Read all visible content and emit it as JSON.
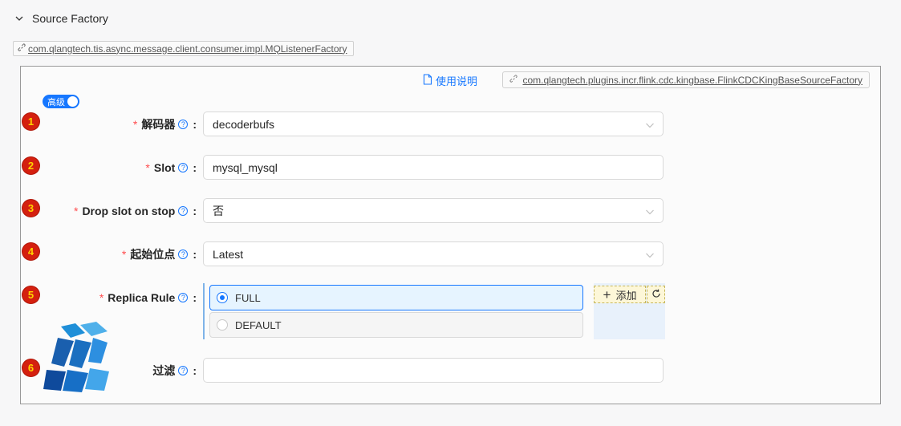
{
  "section": {
    "title": "Source Factory"
  },
  "class_tag": {
    "text": "com.qlangtech.tis.async.message.client.consumer.impl.MQListenerFactory"
  },
  "doc_link": {
    "label": "使用说明"
  },
  "impl_tag": {
    "text": "com.qlangtech.plugins.incr.flink.cdc.kingbase.FlinkCDCKingBaseSourceFactory"
  },
  "advanced_toggle": {
    "label": "高级",
    "on": true
  },
  "fields": [
    {
      "badge": "1",
      "label": "解码器",
      "required": true,
      "type": "select",
      "value": "decoderbufs"
    },
    {
      "badge": "2",
      "label": "Slot",
      "required": true,
      "type": "input",
      "value": "mysql_mysql"
    },
    {
      "badge": "3",
      "label": "Drop slot on stop",
      "required": true,
      "type": "select",
      "value": "否"
    },
    {
      "badge": "4",
      "label": "起始位点",
      "required": true,
      "type": "select",
      "value": "Latest"
    },
    {
      "badge": "5",
      "label": "Replica Rule",
      "required": true,
      "type": "radio",
      "options": [
        "FULL",
        "DEFAULT"
      ],
      "selected": "FULL"
    },
    {
      "badge": "6",
      "label": "过滤",
      "required": false,
      "type": "input",
      "value": ""
    }
  ],
  "replica_actions": {
    "add_label": "添加"
  },
  "help_glyph": "?",
  "colon": ":",
  "required_mark": "*",
  "colors": {
    "accent": "#1677ff",
    "required": "#ff4d4f",
    "badge_bg": "#d4200f",
    "badge_fg": "#ffd200"
  }
}
